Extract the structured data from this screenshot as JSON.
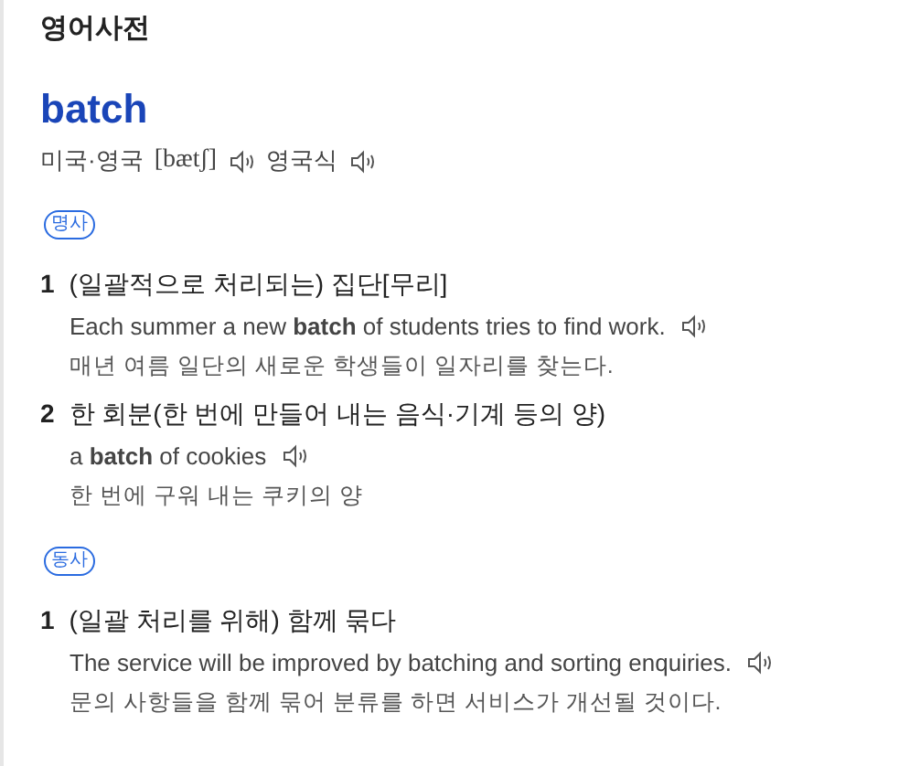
{
  "title": "영어사전",
  "entry": {
    "word": "batch",
    "pronunciations": [
      {
        "label": "미국·영국",
        "ipa": "[bætʃ]"
      },
      {
        "label": "영국식"
      }
    ],
    "sections": [
      {
        "pos": "명사",
        "senses": [
          {
            "number": "1",
            "meaning": "(일괄적으로 처리되는) 집단[무리]",
            "examples": [
              {
                "text": "Each summer a new **batch** of students tries to find work.",
                "translation": "매년 여름 일단의 새로운 학생들이 일자리를 찾는다."
              }
            ]
          },
          {
            "number": "2",
            "meaning": "한 회분(한 번에 만들어 내는 음식·기계 등의 양)",
            "examples": [
              {
                "text": "a **batch** of cookies",
                "translation": "한 번에 구워 내는 쿠키의 양"
              }
            ]
          }
        ]
      },
      {
        "pos": "동사",
        "senses": [
          {
            "number": "1",
            "meaning": "(일괄 처리를 위해) 함께 묶다",
            "examples": [
              {
                "text": "The service will be improved by batching and sorting enquiries.",
                "translation": "문의 사항들을 함께 묶어 분류를 하면 서비스가 개선될 것이다."
              }
            ]
          }
        ]
      }
    ]
  }
}
